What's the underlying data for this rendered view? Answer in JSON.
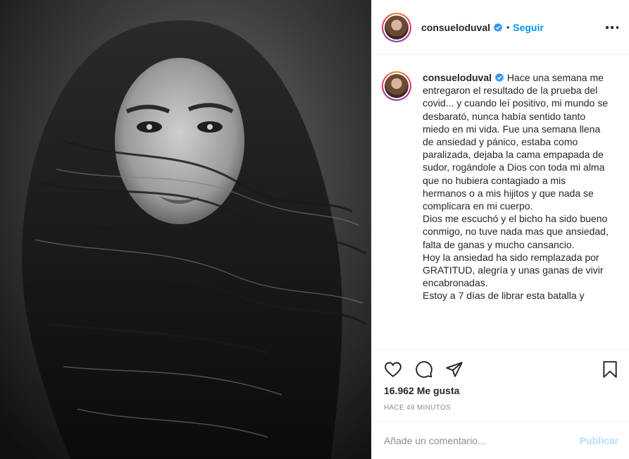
{
  "post": {
    "username": "consueloduval",
    "follow_label": "Seguir",
    "dot": "•",
    "caption_username": "consueloduval",
    "caption": "Hace una semana me entregaron el resultado de la prueba del covid... y cuando leí positivo, mi mundo se desbarató, nunca había sentido tanto miedo en mi vida. Fue una semana llena de ansiedad y pánico, estaba como paralizada, dejaba la cama empapada de sudor, rogándole a Dios con toda mi alma que no hubiera contagiado a mis hermanos o a mis hijitos y que nada se complicara en mi cuerpo.\nDios me escuchó y el bicho ha sido bueno conmigo, no tuve nada mas que ansiedad, falta de ganas y mucho cansancio.\nHoy la ansiedad ha sido remplazada por GRATITUD, alegría y unas ganas de vivir encabronadas.\nEstoy a 7 días de librar esta batalla y",
    "likes": "16.962 Me gusta",
    "timestamp": "HACE 49 MINUTOS"
  },
  "comment": {
    "placeholder": "Añade un comentario...",
    "publish_label": "Publicar"
  },
  "icons": {
    "verified": "verified-badge-icon",
    "like": "heart-icon",
    "comment": "comment-bubble-icon",
    "share": "paper-plane-icon",
    "save": "bookmark-icon",
    "more": "more-options-icon"
  },
  "colors": {
    "link_blue": "#0095f6",
    "publish_disabled": "#b2dffc",
    "muted_text": "#8e8e8e",
    "divider": "#efefef"
  }
}
